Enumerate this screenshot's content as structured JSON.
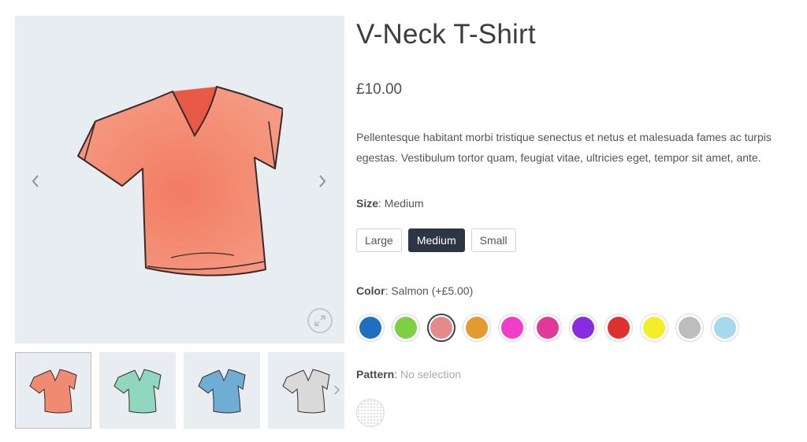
{
  "product": {
    "title": "V-Neck T-Shirt",
    "price": "£10.00",
    "description": "Pellentesque habitant morbi tristique senectus et netus et malesuada fames ac turpis egestas. Vestibulum tortor quam, feugiat vitae, ultricies eget, tempor sit amet, ante."
  },
  "gallery": {
    "prev_icon": "chevron-left-icon",
    "next_icon": "chevron-right-icon",
    "zoom_icon": "expand-icon",
    "thumbnails": [
      {
        "color": "#f08a72",
        "active": true
      },
      {
        "color": "#8fd8bf",
        "active": false
      },
      {
        "color": "#6eaed4",
        "active": false
      },
      {
        "color": "#d9d9d9",
        "active": false
      }
    ]
  },
  "attributes": {
    "size": {
      "label": "Size",
      "selected": "Medium",
      "options": [
        "Large",
        "Medium",
        "Small"
      ]
    },
    "color": {
      "label": "Color",
      "selected": "Salmon (+£5.00)",
      "swatches": [
        {
          "hex": "#1f6fbf"
        },
        {
          "hex": "#7ed043"
        },
        {
          "hex": "#e38a8a",
          "selected": true
        },
        {
          "hex": "#e39a2e"
        },
        {
          "hex": "#f03ec9"
        },
        {
          "hex": "#e0399a"
        },
        {
          "hex": "#8a2be2"
        },
        {
          "hex": "#e03131"
        },
        {
          "hex": "#f2ee27"
        },
        {
          "hex": "#bdbdbd"
        },
        {
          "hex": "#a6d9ec"
        }
      ]
    },
    "pattern": {
      "label": "Pattern",
      "selected": "No selection"
    }
  },
  "colors": {
    "accent": "#2e3545",
    "image_bg": "#e8edf2"
  }
}
